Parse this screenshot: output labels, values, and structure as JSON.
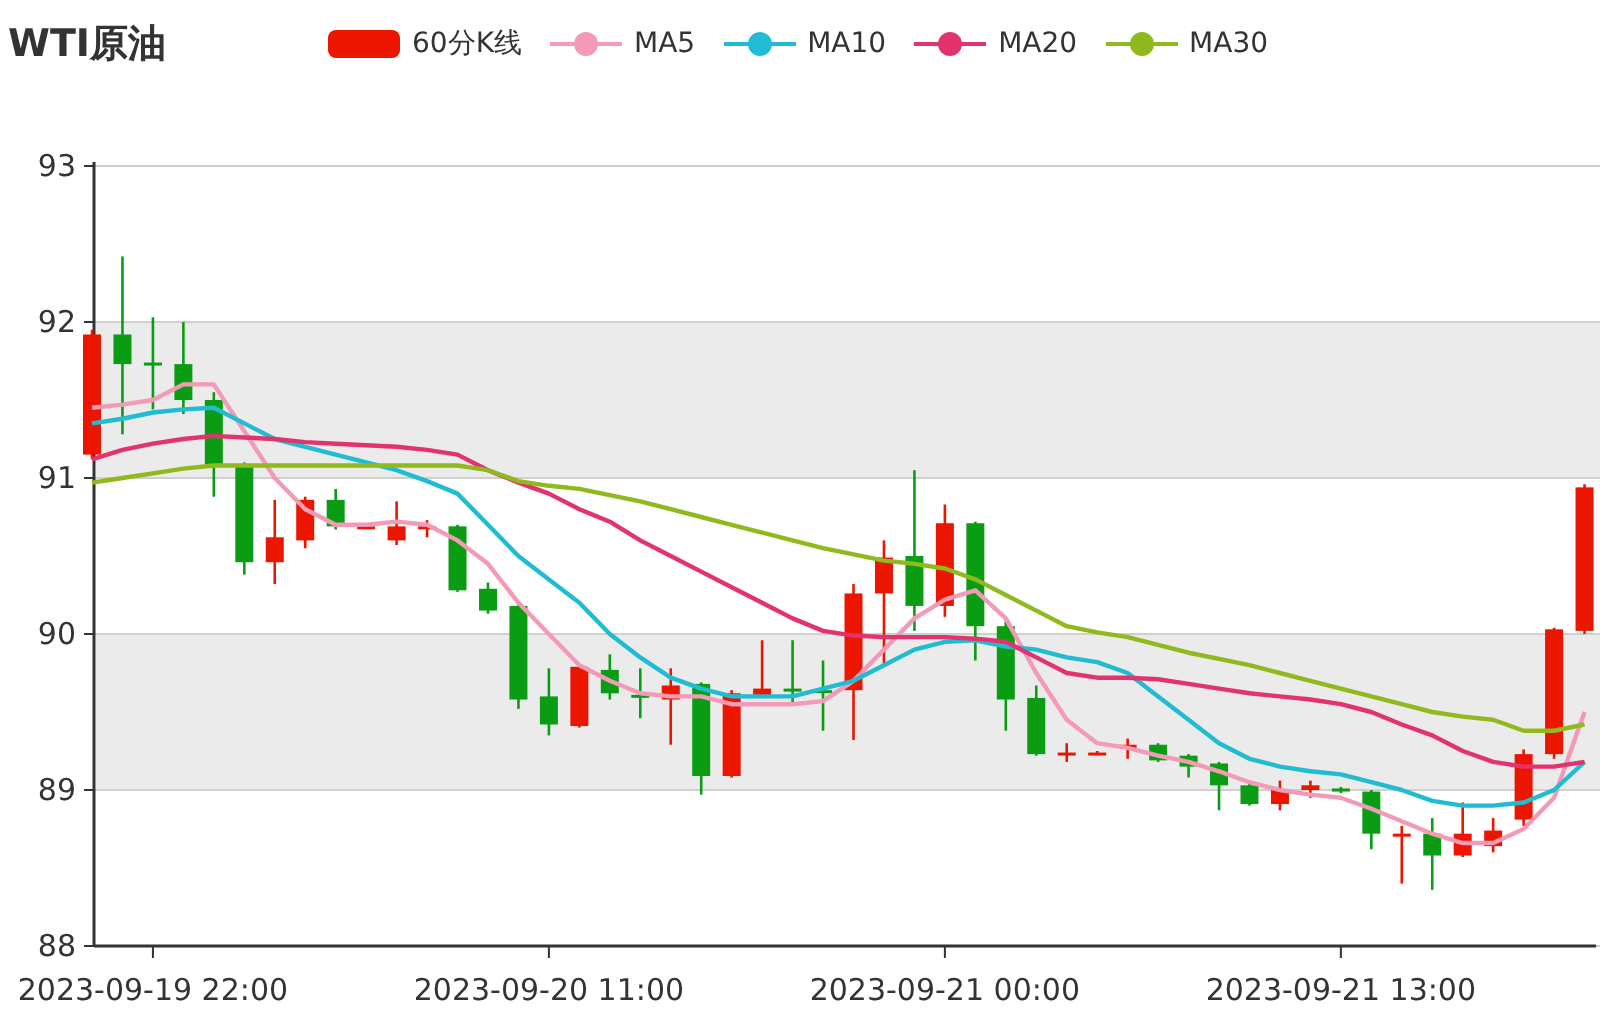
{
  "chart": {
    "candle_legend": {
      "label": "60分K线",
      "color": "#eb1500"
    },
    "chart_data": {
      "type": "candlestick",
      "title": "WTI原油",
      "categories": [
        null,
        null,
        "2023-09-19 22:00",
        null,
        null,
        null,
        null,
        null,
        null,
        null,
        null,
        null,
        null,
        null,
        null,
        "2023-09-20 11:00",
        null,
        null,
        null,
        null,
        null,
        null,
        null,
        null,
        null,
        null,
        null,
        null,
        "2023-09-21 00:00",
        null,
        null,
        null,
        null,
        null,
        null,
        null,
        null,
        null,
        null,
        null,
        null,
        "2023-09-21 13:00",
        null,
        null,
        null,
        null,
        null,
        null,
        null,
        null
      ],
      "ylim": [
        88,
        93
      ],
      "yticks": [
        88,
        89,
        90,
        91,
        92,
        93
      ],
      "grid": true,
      "ohlc": [
        [
          91.15,
          91.95,
          91.12,
          91.92
        ],
        [
          91.92,
          92.42,
          91.28,
          91.73
        ],
        [
          91.74,
          92.03,
          91.44,
          91.73
        ],
        [
          91.73,
          92.0,
          91.41,
          91.5
        ],
        [
          91.5,
          91.55,
          90.88,
          91.09
        ],
        [
          91.09,
          91.1,
          90.38,
          90.46
        ],
        [
          90.46,
          90.86,
          90.32,
          90.62
        ],
        [
          90.6,
          90.88,
          90.55,
          90.86
        ],
        [
          90.86,
          90.93,
          90.67,
          90.69
        ],
        [
          90.68,
          90.7,
          90.68,
          90.69
        ],
        [
          90.6,
          90.85,
          90.57,
          90.69
        ],
        [
          90.68,
          90.73,
          90.62,
          90.69
        ],
        [
          90.69,
          90.7,
          90.27,
          90.28
        ],
        [
          90.29,
          90.33,
          90.13,
          90.15
        ],
        [
          90.18,
          90.19,
          89.52,
          89.58
        ],
        [
          89.6,
          89.78,
          89.35,
          89.42
        ],
        [
          89.41,
          89.8,
          89.4,
          89.79
        ],
        [
          89.77,
          89.87,
          89.58,
          89.62
        ],
        [
          89.61,
          89.78,
          89.46,
          89.6
        ],
        [
          89.58,
          89.78,
          89.29,
          89.67
        ],
        [
          89.68,
          89.69,
          88.97,
          89.09
        ],
        [
          89.09,
          89.64,
          89.08,
          89.62
        ],
        [
          89.6,
          89.96,
          89.6,
          89.65
        ],
        [
          89.65,
          89.96,
          89.56,
          89.64
        ],
        [
          89.64,
          89.83,
          89.38,
          89.63
        ],
        [
          89.64,
          90.32,
          89.32,
          90.26
        ],
        [
          90.26,
          90.6,
          89.81,
          90.49
        ],
        [
          90.5,
          91.05,
          90.02,
          90.18
        ],
        [
          90.18,
          90.83,
          90.11,
          90.71
        ],
        [
          90.71,
          90.72,
          89.83,
          90.05
        ],
        [
          90.05,
          90.09,
          89.38,
          89.58
        ],
        [
          89.59,
          89.67,
          89.22,
          89.23
        ],
        [
          89.23,
          89.3,
          89.18,
          89.24
        ],
        [
          89.23,
          89.25,
          89.23,
          89.24
        ],
        [
          89.28,
          89.33,
          89.2,
          89.29
        ],
        [
          89.29,
          89.3,
          89.18,
          89.19
        ],
        [
          89.22,
          89.23,
          89.08,
          89.15
        ],
        [
          89.17,
          89.18,
          88.87,
          89.03
        ],
        [
          89.03,
          89.04,
          88.9,
          88.91
        ],
        [
          88.91,
          89.06,
          88.87,
          89.0
        ],
        [
          89.0,
          89.06,
          88.95,
          89.03
        ],
        [
          89.01,
          89.02,
          88.98,
          88.99
        ],
        [
          88.99,
          89.0,
          88.62,
          88.72
        ],
        [
          88.71,
          88.77,
          88.4,
          88.72
        ],
        [
          88.72,
          88.82,
          88.36,
          88.58
        ],
        [
          88.58,
          88.92,
          88.57,
          88.72
        ],
        [
          88.64,
          88.82,
          88.6,
          88.74
        ],
        [
          88.81,
          89.26,
          88.77,
          89.23
        ],
        [
          89.23,
          90.04,
          89.2,
          90.03
        ],
        [
          90.02,
          90.96,
          90.0,
          90.94
        ]
      ],
      "series": [
        {
          "name": "MA5",
          "type": "line",
          "color": "#f39bb6",
          "values": [
            91.45,
            91.47,
            91.5,
            91.6,
            91.6,
            91.3,
            91.0,
            90.8,
            90.7,
            90.7,
            90.72,
            90.7,
            90.6,
            90.45,
            90.2,
            90.0,
            89.8,
            89.7,
            89.62,
            89.6,
            89.6,
            89.55,
            89.55,
            89.55,
            89.57,
            89.7,
            89.9,
            90.1,
            90.22,
            90.28,
            90.1,
            89.75,
            89.45,
            89.3,
            89.27,
            89.22,
            89.18,
            89.12,
            89.05,
            89.0,
            88.97,
            88.95,
            88.88,
            88.8,
            88.72,
            88.66,
            88.66,
            88.75,
            88.95,
            89.5
          ]
        },
        {
          "name": "MA10",
          "type": "line",
          "color": "#1fbcd2",
          "values": [
            91.35,
            91.38,
            91.42,
            91.44,
            91.45,
            91.35,
            91.25,
            91.2,
            91.15,
            91.1,
            91.05,
            90.98,
            90.9,
            90.7,
            90.5,
            90.35,
            90.2,
            90.0,
            89.85,
            89.72,
            89.65,
            89.6,
            89.6,
            89.6,
            89.65,
            89.7,
            89.8,
            89.9,
            89.95,
            89.96,
            89.92,
            89.9,
            89.85,
            89.82,
            89.75,
            89.6,
            89.45,
            89.3,
            89.2,
            89.15,
            89.12,
            89.1,
            89.05,
            89.0,
            88.93,
            88.9,
            88.9,
            88.92,
            89.0,
            89.18
          ]
        },
        {
          "name": "MA20",
          "type": "line",
          "color": "#e2336f",
          "values": [
            91.12,
            91.18,
            91.22,
            91.25,
            91.27,
            91.26,
            91.25,
            91.23,
            91.22,
            91.21,
            91.2,
            91.18,
            91.15,
            91.05,
            90.97,
            90.9,
            90.8,
            90.72,
            90.6,
            90.5,
            90.4,
            90.3,
            90.2,
            90.1,
            90.02,
            89.99,
            89.98,
            89.98,
            89.98,
            89.97,
            89.95,
            89.85,
            89.75,
            89.72,
            89.72,
            89.71,
            89.68,
            89.65,
            89.62,
            89.6,
            89.58,
            89.55,
            89.5,
            89.42,
            89.35,
            89.25,
            89.18,
            89.15,
            89.15,
            89.18
          ]
        },
        {
          "name": "MA30",
          "type": "line",
          "color": "#8fb91c",
          "values": [
            90.97,
            91.0,
            91.03,
            91.06,
            91.08,
            91.08,
            91.08,
            91.08,
            91.08,
            91.08,
            91.08,
            91.08,
            91.08,
            91.05,
            90.98,
            90.95,
            90.93,
            90.89,
            90.85,
            90.8,
            90.75,
            90.7,
            90.65,
            90.6,
            90.55,
            90.51,
            90.47,
            90.45,
            90.42,
            90.35,
            90.25,
            90.15,
            90.05,
            90.01,
            89.98,
            89.93,
            89.88,
            89.84,
            89.8,
            89.75,
            89.7,
            89.65,
            89.6,
            89.55,
            89.5,
            89.47,
            89.45,
            89.38,
            89.38,
            89.42
          ]
        }
      ]
    }
  }
}
